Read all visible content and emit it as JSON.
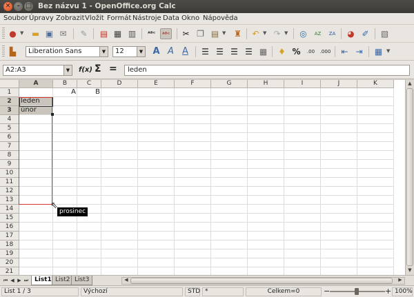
{
  "window": {
    "title": "Bez názvu 1 - OpenOffice.org Calc",
    "close_glyph": "✕",
    "min_glyph": "–",
    "max_glyph": "□"
  },
  "menu": {
    "items": [
      "Soubor",
      "Úpravy",
      "Zobrazit",
      "Vložit",
      "Formát",
      "Nástroje",
      "Data",
      "Okno",
      "Nápověda"
    ]
  },
  "toolbar": {
    "font_name": "Liberation Sans",
    "font_size": "12"
  },
  "formula_bar": {
    "name_box": "A2:A3",
    "function_wizard": "f(x)",
    "sum_symbol": "Σ",
    "equals_symbol": "=",
    "content": "leden"
  },
  "grid": {
    "columns": [
      "A",
      "B",
      "C",
      "D",
      "E",
      "F",
      "G",
      "H",
      "I",
      "J",
      "K"
    ],
    "rows": [
      "1",
      "2",
      "3",
      "4",
      "5",
      "6",
      "7",
      "8",
      "9",
      "10",
      "11",
      "12",
      "13",
      "14",
      "15",
      "16",
      "17",
      "18",
      "19",
      "20",
      "21",
      "22"
    ],
    "cells": {
      "B1": "A",
      "C1": "B",
      "A2": "leden",
      "A3": "únor"
    },
    "autofill_tooltip": "prosinec"
  },
  "sheet_tabs": {
    "tabs": [
      "List1",
      "List2",
      "List3"
    ],
    "active": "List1"
  },
  "status_bar": {
    "sheet": "List 1 / 3",
    "page_style": "Výchozí",
    "mode": "STD",
    "selection_mode": "*",
    "sum": "Celkem=0",
    "zoom": "100%",
    "zoom_minus": "−",
    "zoom_plus": "+"
  },
  "colors": {
    "accent_red": "#d9342a",
    "selection": "#c9c5bd",
    "titlebar": "#3b3a37"
  },
  "icons": [
    "new-document-icon",
    "open-icon",
    "save-icon",
    "email-icon",
    "edit-file-icon",
    "pdf-icon",
    "print-icon",
    "print-preview-icon",
    "spellcheck-icon",
    "autospellcheck-icon",
    "cut-icon",
    "copy-icon",
    "paste-icon",
    "clone-formatting-icon",
    "undo-icon",
    "redo-icon",
    "hyperlink-icon",
    "sort-ascending-icon",
    "sort-descending-icon",
    "chart-icon",
    "show-draw-functions-icon",
    "styles-icon",
    "bold-icon",
    "italic-icon",
    "underline-icon",
    "align-left-icon",
    "align-center-icon",
    "align-right-icon",
    "justify-icon",
    "merge-cells-icon",
    "currency-icon",
    "percent-icon",
    "decimal-add-icon",
    "decimal-delete-icon",
    "indent-decrease-icon",
    "indent-increase-icon",
    "borders-icon"
  ]
}
